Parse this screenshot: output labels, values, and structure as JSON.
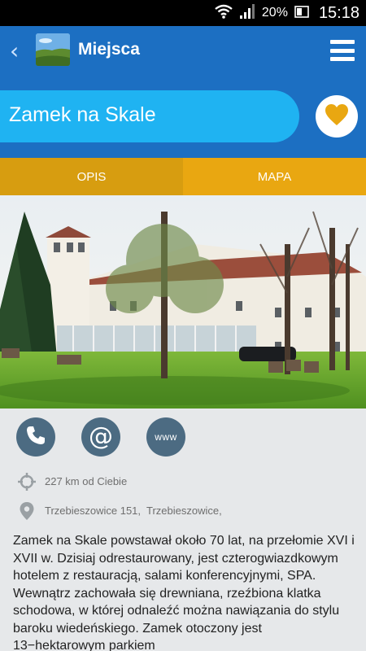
{
  "status_bar": {
    "battery": "20%",
    "time": "15:18",
    "icons": [
      "wifi-icon",
      "signal-icon",
      "battery-icon"
    ]
  },
  "app_bar": {
    "back_icon": "chevron-left-icon",
    "title": "Miejsca",
    "menu_icon": "hamburger-menu-icon"
  },
  "place": {
    "name": "Zamek na Skale",
    "favorite_icon": "heart-icon"
  },
  "tabs": [
    {
      "label": "OPIS",
      "active": true
    },
    {
      "label": "MAPA",
      "active": false
    }
  ],
  "actions": [
    {
      "icon": "phone-icon"
    },
    {
      "icon": "email-icon"
    },
    {
      "icon": "www-icon",
      "label": "www"
    }
  ],
  "info": {
    "distance": "227 km od Ciebie",
    "address": "Trzebieszowice 151,  Trzebieszowice,"
  },
  "description": "Zamek na Skale powstawał około 70 lat, na przełomie XVI i XVII w. Dzisiaj odrestaurowany, jest czterogwiazdkowym hotelem z restauracją, salami konferencyjnymi, SPA. Wewnątrz zachowała się drewniana, rzeźbiona klatka schodowa, w której odnaleźć można nawiązania do stylu baroku wiedeńskiego. Zamek otoczony jest 13−hektarowym parkiem",
  "colors": {
    "primary": "#1c6fc2",
    "title_pill": "#1fb3f2",
    "tab_active": "#d79d10",
    "tab_inactive": "#e9a711",
    "heart": "#e9a711",
    "action_button": "#4c6b82"
  }
}
